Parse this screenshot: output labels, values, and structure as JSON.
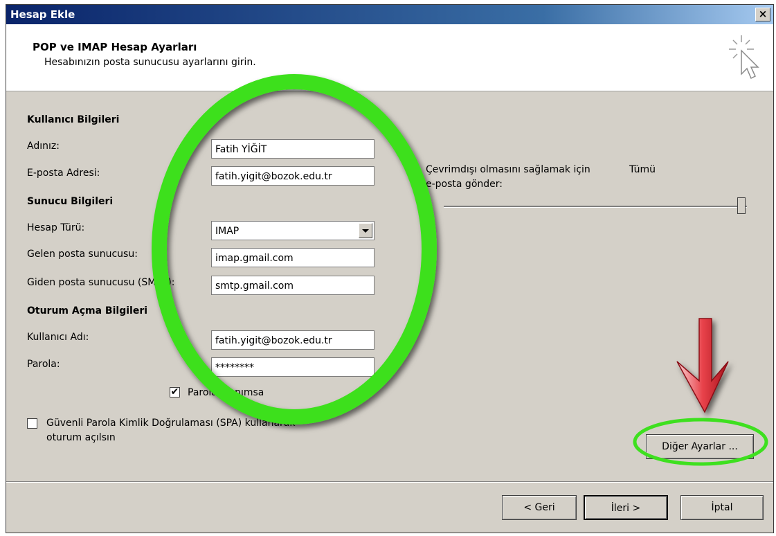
{
  "window": {
    "title": "Hesap Ekle"
  },
  "header": {
    "title": "POP ve IMAP Hesap Ayarları",
    "subtitle": "Hesabınızın posta sunucusu ayarlarını girin."
  },
  "user_info": {
    "section": "Kullanıcı Bilgileri",
    "name_label": "Adınız:",
    "name_value": "Fatih YİĞİT",
    "email_label": "E-posta Adresi:",
    "email_value": "fatih.yigit@bozok.edu.tr"
  },
  "server_info": {
    "section": "Sunucu Bilgileri",
    "type_label": "Hesap Türü:",
    "type_value": "IMAP",
    "incoming_label": "Gelen posta sunucusu:",
    "incoming_value": "imap.gmail.com",
    "outgoing_label": "Giden posta sunucusu (SMTP):",
    "outgoing_value": "smtp.gmail.com"
  },
  "login_info": {
    "section": "Oturum Açma Bilgileri",
    "username_label": "Kullanıcı Adı:",
    "username_value": "fatih.yigit@bozok.edu.tr",
    "password_label": "Parola:",
    "password_value": "********",
    "remember_label": "Parolayı anımsa",
    "remember_checked": true,
    "spa_label_line1": "Güvenli Parola Kimlik Doğrulaması (SPA) kullanarak",
    "spa_label_line2": "oturum açılsın",
    "spa_checked": false
  },
  "offline": {
    "line1": "Çevrimdışı olmasını sağlamak için",
    "line2": "e-posta gönder:",
    "slider_value_label": "Tümü",
    "slider_level": 1.0
  },
  "buttons": {
    "more_settings": "Diğer Ayarlar ...",
    "back": "< Geri",
    "next": "İleri >",
    "cancel": "İptal"
  },
  "colors": {
    "highlight_ring": "#3ee01f",
    "arrow": "#e8424a",
    "titlebar": "#0a246a"
  },
  "icons": {
    "wizard": "cursor-sparkle-icon",
    "close": "close-icon"
  }
}
